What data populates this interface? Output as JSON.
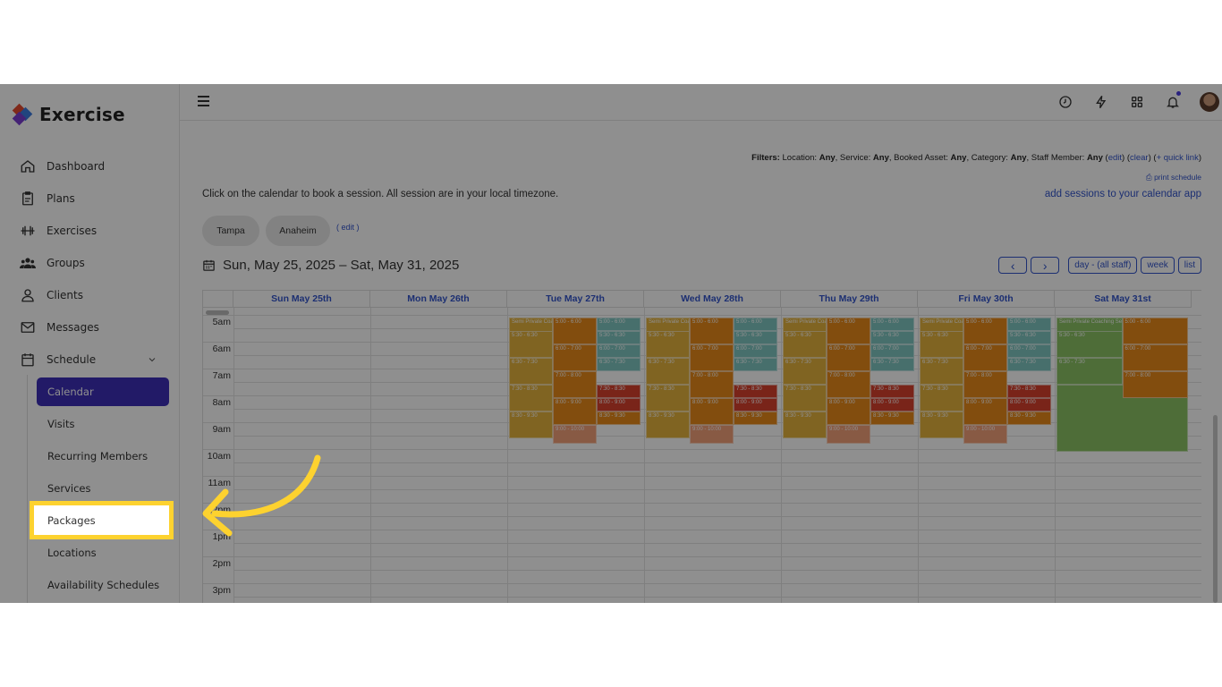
{
  "app": {
    "name": "Exercise"
  },
  "sidebar": {
    "items": [
      {
        "label": "Dashboard",
        "icon": "home-icon"
      },
      {
        "label": "Plans",
        "icon": "clipboard-icon"
      },
      {
        "label": "Exercises",
        "icon": "dumbbell-icon"
      },
      {
        "label": "Groups",
        "icon": "users-icon"
      },
      {
        "label": "Clients",
        "icon": "user-icon"
      },
      {
        "label": "Messages",
        "icon": "mail-icon"
      },
      {
        "label": "Schedule",
        "icon": "calendar-icon"
      }
    ],
    "schedule_sub": [
      {
        "label": "Calendar",
        "active": true
      },
      {
        "label": "Visits"
      },
      {
        "label": "Recurring Members"
      },
      {
        "label": "Services"
      },
      {
        "label": "Packages",
        "highlighted": true
      },
      {
        "label": "Locations"
      },
      {
        "label": "Availability Schedules"
      }
    ]
  },
  "filters": {
    "label": "Filters:",
    "location_k": " Location: ",
    "location_v": "Any",
    "service_k": ", Service: ",
    "service_v": "Any",
    "asset_k": ", Booked Asset: ",
    "asset_v": "Any",
    "category_k": ", Category: ",
    "category_v": "Any",
    "staff_k": ", Staff Member: ",
    "staff_v": "Any",
    "edit": "edit",
    "clear": "clear",
    "quick": "+ quick link",
    "print": "print schedule"
  },
  "intro": "Click on the calendar to book a session. All session are in your local timezone.",
  "add_sessions": "add sessions to your calendar app",
  "locations": {
    "tabs": [
      "Tampa",
      "Anaheim"
    ],
    "edit": "( edit )"
  },
  "calendar": {
    "range": "Sun, May 25, 2025 – Sat, May 31, 2025",
    "prev": "‹",
    "next": "›",
    "view_day": "day - (all staff)",
    "view_week": "week",
    "view_list": "list",
    "days": [
      "Sun May 25th",
      "Mon May 26th",
      "Tue May 27th",
      "Wed May 28th",
      "Thu May 29th",
      "Fri May 30th",
      "Sat May 31st"
    ],
    "hours": [
      "5am",
      "6am",
      "7am",
      "8am",
      "9am",
      "10am",
      "11am",
      "12pm",
      "1pm",
      "2pm",
      "3pm"
    ]
  },
  "event_labels": {
    "semi": "Semi Private Coaching Session",
    "t500": "5:00 - 6:00",
    "t530": "5:30 - 6:30",
    "t600": "6:00 - 7:00",
    "t630": "6:30 - 7:30",
    "t700": "7:00 - 8:00",
    "t730": "7:30 - 8:30",
    "t800": "8:00 - 9:00",
    "t830": "8:30 - 9:30",
    "t900": "9:00 - 10:00"
  },
  "colors": {
    "accent": "#3d2fb8",
    "link": "#3355cc",
    "highlight": "#fdd22f"
  }
}
